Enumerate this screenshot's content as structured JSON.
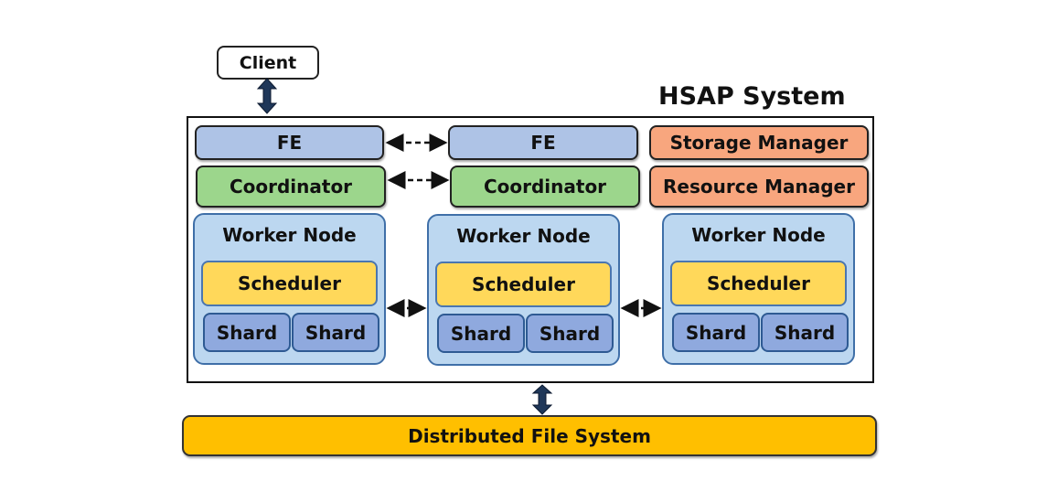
{
  "client": {
    "label": "Client"
  },
  "system": {
    "title": "HSAP System"
  },
  "frontends": [
    {
      "label": "FE"
    },
    {
      "label": "FE"
    }
  ],
  "coordinators": [
    {
      "label": "Coordinator"
    },
    {
      "label": "Coordinator"
    }
  ],
  "managers": {
    "storage": "Storage Manager",
    "resource": "Resource Manager"
  },
  "workers": [
    {
      "title": "Worker Node",
      "scheduler": "Scheduler",
      "shards": [
        "Shard",
        "Shard"
      ]
    },
    {
      "title": "Worker Node",
      "scheduler": "Scheduler",
      "shards": [
        "Shard",
        "Shard"
      ]
    },
    {
      "title": "Worker Node",
      "scheduler": "Scheduler",
      "shards": [
        "Shard",
        "Shard"
      ]
    }
  ],
  "storage": {
    "label": "Distributed File System"
  },
  "colors": {
    "fe": "#aec3e6",
    "coordinator": "#9cd68c",
    "manager": "#f8a67e",
    "worker": "#bcd7f0",
    "scheduler": "#ffd85a",
    "shard": "#8fa9de",
    "dfs": "#ffbf00"
  }
}
